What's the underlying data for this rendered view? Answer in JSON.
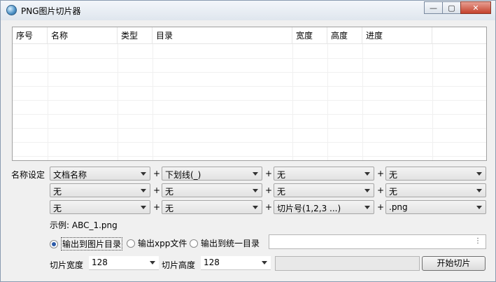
{
  "window": {
    "title": "PNG图片切片器",
    "minimize": "—",
    "maximize": "▢",
    "close": "✕"
  },
  "list": {
    "columns": [
      "序号",
      "名称",
      "类型",
      "目录",
      "宽度",
      "高度",
      "进度"
    ]
  },
  "naming": {
    "label": "名称设定",
    "plus": "+",
    "rows": [
      [
        "文档名称",
        "下划线(_)",
        "无",
        "无"
      ],
      [
        "无",
        "无",
        "无",
        "无"
      ],
      [
        "无",
        "无",
        "切片号(1,2,3 ...)",
        ".png"
      ]
    ]
  },
  "example": "示例: ABC_1.png",
  "output": {
    "options": [
      "输出到图片目录",
      "输出xpp文件",
      "输出到统一目录"
    ],
    "selected": 0,
    "browse_label": "⋮"
  },
  "slice": {
    "width_label": "切片宽度",
    "width_value": "128",
    "height_label": "切片高度",
    "height_value": "128",
    "start_button": "开始切片"
  }
}
